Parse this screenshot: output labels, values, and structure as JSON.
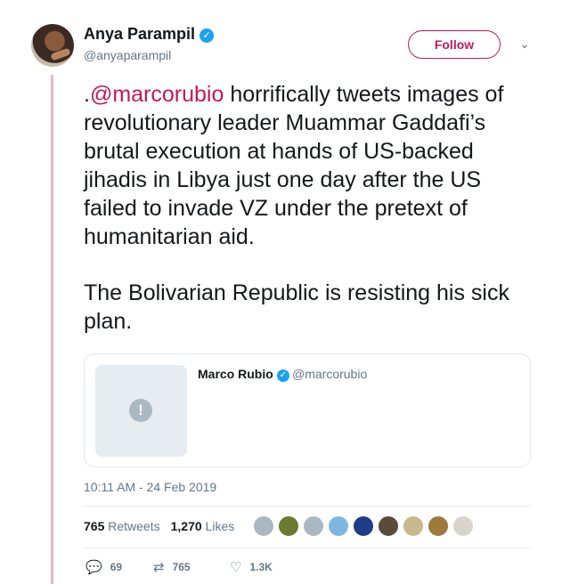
{
  "author": {
    "name": "Anya Parampil",
    "handle": "@anyaparampil"
  },
  "header": {
    "follow_label": "Follow"
  },
  "tweet": {
    "paragraph1_prefix": ".",
    "paragraph1_mention": "@marcorubio",
    "paragraph1_rest": " horrifically tweets images of revolutionary leader Muammar Gaddafi’s brutal execution at hands of US-backed jihadis in Libya just one day after the US failed to invade VZ under the pretext of humanitarian aid.",
    "paragraph2": "The Bolivarian Republic is resisting his sick plan."
  },
  "quoted_tweet": {
    "name": "Marco Rubio",
    "handle": "@marcorubio",
    "media_icon": "alert-icon"
  },
  "timestamp": "10:11 AM - 24 Feb 2019",
  "stats": {
    "retweets_count": "765",
    "retweets_label": "Retweets",
    "likes_count": "1,270",
    "likes_label": "Likes"
  },
  "liker_avatar_colors": [
    "#aab8c2",
    "#6b7a2e",
    "#aab8c2",
    "#7fb6e0",
    "#1f3c88",
    "#5b4b3a",
    "#c7b98d",
    "#9c7a3c",
    "#d8d4cc"
  ],
  "actions": {
    "replies": "69",
    "retweets": "765",
    "likes": "1.3K"
  },
  "icons": {
    "verified": "verified-badge-icon",
    "caret": "chevron-down-icon",
    "reply": "reply-icon",
    "retweet": "retweet-icon",
    "like": "heart-icon"
  },
  "colors": {
    "accent": "#c2185b",
    "verified": "#1da1f2",
    "muted": "#657786",
    "thread_line": "#e6b9c8"
  }
}
